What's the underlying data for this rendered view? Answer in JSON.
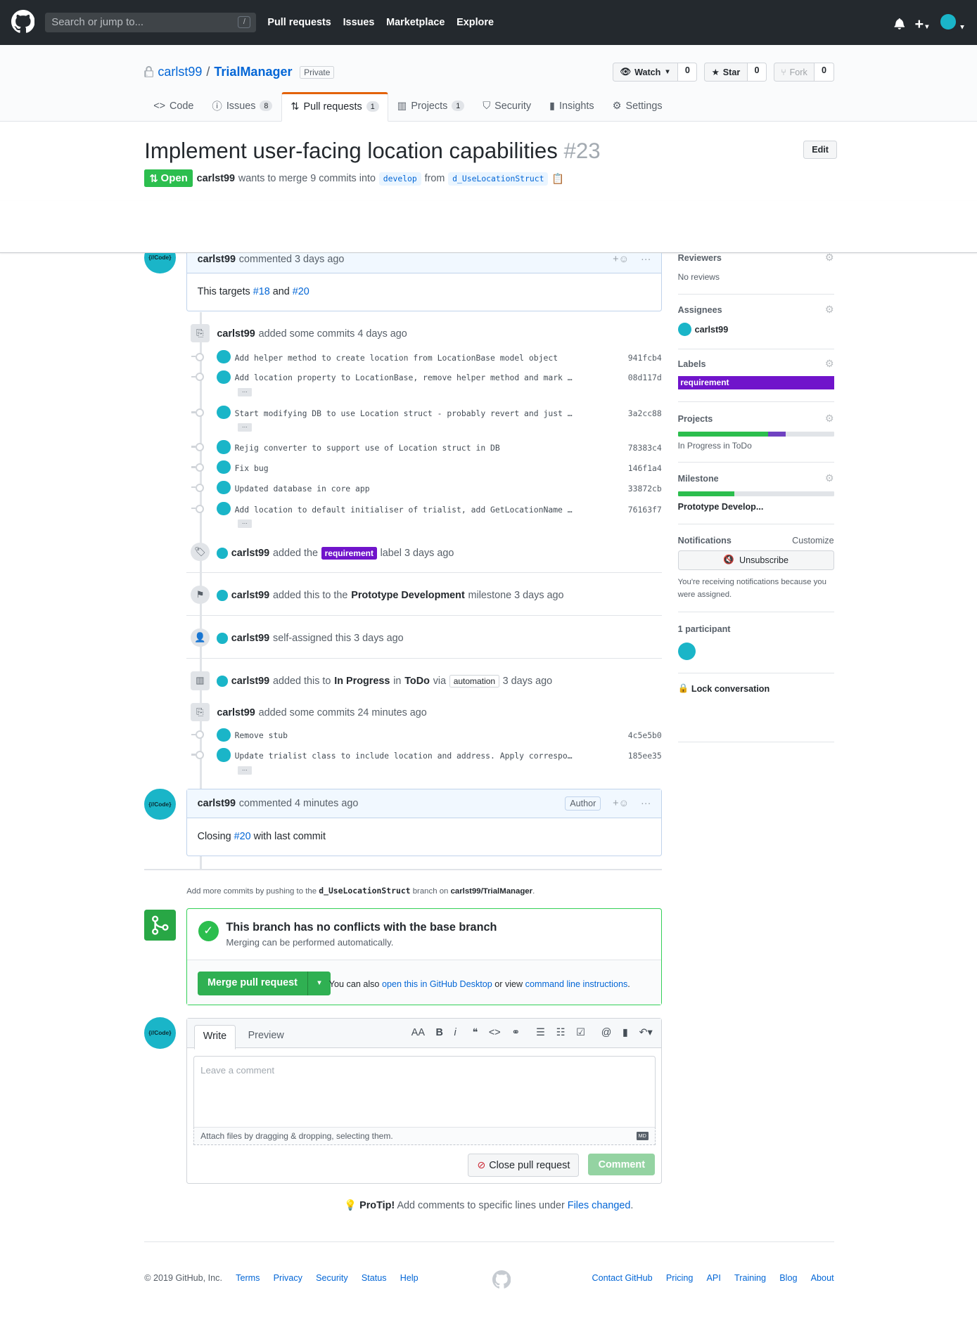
{
  "header": {
    "search_placeholder": "Search or jump to...",
    "search_shortcut": "/",
    "nav": [
      "Pull requests",
      "Issues",
      "Marketplace",
      "Explore"
    ]
  },
  "repo": {
    "owner": "carlst99",
    "separator": "/",
    "name": "TrialManager",
    "visibility": "Private",
    "watch": {
      "label": "Watch",
      "count": "0"
    },
    "star": {
      "label": "Star",
      "count": "0"
    },
    "fork": {
      "label": "Fork",
      "count": "0"
    },
    "tabs": [
      {
        "label": "Code",
        "count": ""
      },
      {
        "label": "Issues",
        "count": "8"
      },
      {
        "label": "Pull requests",
        "count": "1"
      },
      {
        "label": "Projects",
        "count": "1"
      },
      {
        "label": "Security",
        "count": ""
      },
      {
        "label": "Insights",
        "count": ""
      },
      {
        "label": "Settings",
        "count": ""
      }
    ]
  },
  "pr": {
    "title": "Implement user-facing location capabilities",
    "number": "#23",
    "edit": "Edit",
    "state": "Open",
    "author": "carlst99",
    "meta_mid": "wants to merge 9 commits into",
    "base": "develop",
    "from": "from",
    "head": "d_UseLocationStruct"
  },
  "timeline": {
    "first_comment": {
      "author": "carlst99",
      "action": "commented 3 days ago",
      "body_pre": "This targets",
      "ref1": "#18",
      "and": "and",
      "ref2": "#20"
    },
    "commits_group1": {
      "author": "carlst99",
      "action": "added some commits 4 days ago"
    },
    "commits1": [
      {
        "msg": "Add helper method to create location from LocationBase model object",
        "sha": "941fcb4"
      },
      {
        "msg": "Add location property to LocationBase, remove helper method and mark …",
        "sha": "08d117d"
      },
      {
        "msg": "Start modifying DB to use Location struct - probably revert and just …",
        "sha": "3a2cc88"
      },
      {
        "msg": "Rejig converter to support use of Location struct in DB",
        "sha": "78383c4"
      },
      {
        "msg": "Fix bug",
        "sha": "146f1a4"
      },
      {
        "msg": "Updated database in core app",
        "sha": "33872cb"
      },
      {
        "msg": "Add location to default initialiser of trialist, add GetLocationName …",
        "sha": "76163f7"
      }
    ],
    "ellipsis": "…",
    "label_event": {
      "author": "carlst99",
      "pre": "added the",
      "label": "requirement",
      "post": "label 3 days ago"
    },
    "milestone_event": {
      "author": "carlst99",
      "pre": "added this to the",
      "milestone": "Prototype Development",
      "post": "milestone 3 days ago"
    },
    "assign_event": {
      "author": "carlst99",
      "text": "self-assigned this 3 days ago"
    },
    "project_event": {
      "author": "carlst99",
      "pre": "added this to",
      "column": "In Progress",
      "in": "in",
      "project": "ToDo",
      "via": "via",
      "app": "automation",
      "post": "3 days ago"
    },
    "commits_group2": {
      "author": "carlst99",
      "action": "added some commits 24 minutes ago"
    },
    "commits2": [
      {
        "msg": "Remove stub",
        "sha": "4c5e5b0"
      },
      {
        "msg": "Update trialist class to include location and address. Apply correspo…",
        "sha": "185ee35"
      }
    ],
    "second_comment": {
      "author": "carlst99",
      "action": "commented 4 minutes ago",
      "badge": "Author",
      "body_pre": "Closing",
      "ref": "#20",
      "body_post": "with last commit"
    }
  },
  "push_hint": {
    "pre": "Add more commits by pushing to the",
    "branch": "d_UseLocationStruct",
    "mid": "branch on",
    "repo": "carlst99/TrialManager",
    "post": "."
  },
  "merge": {
    "title": "This branch has no conflicts with the base branch",
    "subtitle": "Merging can be performed automatically.",
    "button": "Merge pull request",
    "alt_pre": "You can also",
    "alt_link1": "open this in GitHub Desktop",
    "alt_mid": "or view",
    "alt_link2": "command line instructions",
    "alt_post": "."
  },
  "form": {
    "write": "Write",
    "preview": "Preview",
    "placeholder": "Leave a comment",
    "attach": "Attach files by dragging & dropping, selecting them.",
    "close_button": "Close pull request",
    "comment_button": "Comment",
    "md": "MD"
  },
  "protip": {
    "bold": "ProTip!",
    "text": "Add comments to specific lines under",
    "link": "Files changed",
    "end": "."
  },
  "sidebar": {
    "reviewers": {
      "title": "Reviewers",
      "value": "No reviews"
    },
    "assignees": {
      "title": "Assignees",
      "value": "carlst99"
    },
    "labels": {
      "title": "Labels",
      "value": "requirement"
    },
    "projects": {
      "title": "Projects",
      "value": "In Progress in ToDo",
      "progress_done": 0.58,
      "progress_in_progress": 0.11
    },
    "milestone": {
      "title": "Milestone",
      "value": "Prototype Develop...",
      "progress": 0.36
    },
    "notifications": {
      "title": "Notifications",
      "customize": "Customize",
      "button": "Unsubscribe",
      "reason": "You're receiving notifications because you were assigned."
    },
    "participants": {
      "title": "1 participant"
    },
    "lock": "Lock conversation"
  },
  "footer": {
    "copyright": "© 2019 GitHub, Inc.",
    "left_links": [
      "Terms",
      "Privacy",
      "Security",
      "Status",
      "Help"
    ],
    "right_links": [
      "Contact GitHub",
      "Pricing",
      "API",
      "Training",
      "Blog",
      "About"
    ]
  },
  "avatar_text": "{//Code}",
  "colors": {
    "open": "#2cbe4e",
    "label": "#7014cb",
    "link": "#0366d6",
    "header": "#24292e",
    "accent_tab": "#e36209"
  }
}
